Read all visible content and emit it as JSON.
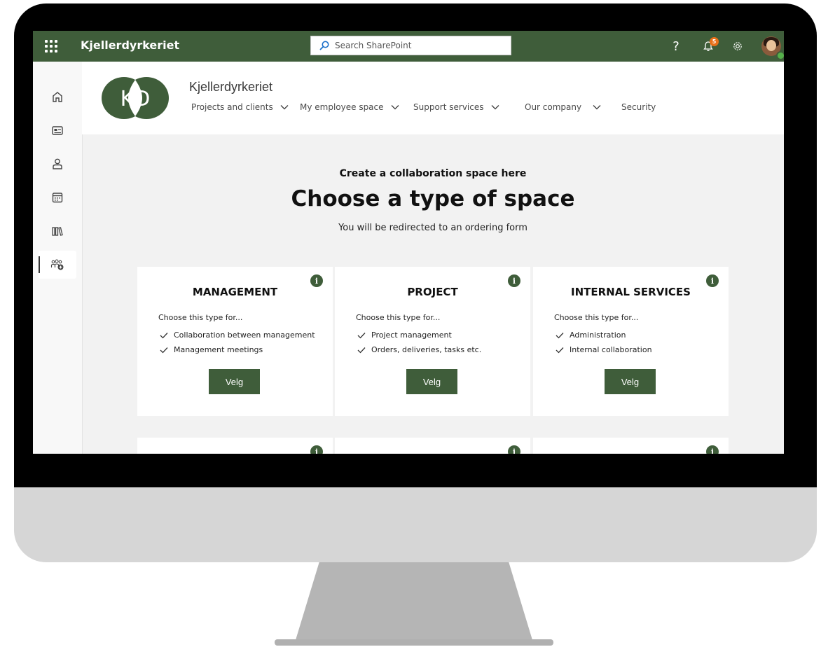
{
  "suitebar": {
    "site_name": "Kjellerdyrkeriet",
    "search_placeholder": "Search SharePoint",
    "help_label": "?",
    "notification_count": "5"
  },
  "rail": {
    "items": [
      "home-icon",
      "news-icon",
      "person-icon",
      "calendar-icon",
      "library-icon",
      "add-team-icon"
    ]
  },
  "header": {
    "logo_text": "KD",
    "site_title": "Kjellerdyrkeriet",
    "nav": [
      {
        "label": "Projects and clients"
      },
      {
        "label": "My employee space"
      },
      {
        "label": "Support services"
      },
      {
        "label": "Our company"
      },
      {
        "label": "Security"
      }
    ]
  },
  "main": {
    "subtitle": "Create a collaboration space here",
    "title": "Choose a type of space",
    "hint": "You will be redirected to an ordering form",
    "cards": [
      {
        "title": "MANAGEMENT",
        "lead": "Choose this type for...",
        "bullets": [
          "Collaboration between management",
          "Management meetings"
        ],
        "button": "Velg"
      },
      {
        "title": "PROJECT",
        "lead": "Choose this type for...",
        "bullets": [
          "Project management",
          "Orders, deliveries, tasks etc."
        ],
        "button": "Velg"
      },
      {
        "title": "INTERNAL SERVICES",
        "lead": "Choose this type for...",
        "bullets": [
          "Administration",
          "Internal collaboration"
        ],
        "button": "Velg"
      }
    ],
    "info_icon": "i"
  },
  "colors": {
    "brand_green": "#3f5d3a",
    "badge_orange": "#e8701a",
    "page_bg": "#f2f2f2"
  }
}
